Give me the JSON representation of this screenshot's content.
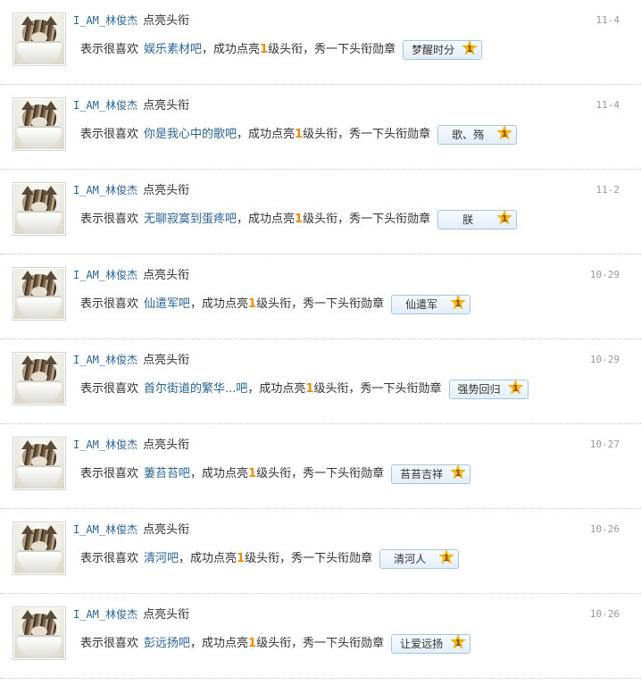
{
  "feed": [
    {
      "user": "I_AM_林俊杰",
      "action": "点亮头衔",
      "date": "11-4",
      "prefix": "表示很喜欢",
      "bar": "娱乐素材吧",
      "mid": "，成功点亮",
      "level": "1",
      "suffix": "级头衔，秀一下头衔勋章",
      "badge": "梦醒时分",
      "badge_level": "1"
    },
    {
      "user": "I_AM_林俊杰",
      "action": "点亮头衔",
      "date": "11-4",
      "prefix": "表示很喜欢",
      "bar": "你是我心中的歌吧",
      "mid": "，成功点亮",
      "level": "1",
      "suffix": "级头衔，秀一下头衔勋章",
      "badge": "歌、殇",
      "badge_level": "1"
    },
    {
      "user": "I_AM_林俊杰",
      "action": "点亮头衔",
      "date": "11-2",
      "prefix": "表示很喜欢",
      "bar": "无聊寂寞到蛋疼吧",
      "mid": "，成功点亮",
      "level": "1",
      "suffix": "级头衔，秀一下头衔勋章",
      "badge": "朕",
      "badge_level": "1"
    },
    {
      "user": "I_AM_林俊杰",
      "action": "点亮头衔",
      "date": "10-29",
      "prefix": "表示很喜欢",
      "bar": "仙遣军吧",
      "mid": "，成功点亮",
      "level": "1",
      "suffix": "级头衔，秀一下头衔勋章",
      "badge": "仙遣军",
      "badge_level": "1"
    },
    {
      "user": "I_AM_林俊杰",
      "action": "点亮头衔",
      "date": "10-29",
      "prefix": "表示很喜欢",
      "bar": "首尔街道的繁华...吧",
      "mid": "，成功点亮",
      "level": "1",
      "suffix": "级头衔，秀一下头衔勋章",
      "badge": "强势回归",
      "badge_level": "1"
    },
    {
      "user": "I_AM_林俊杰",
      "action": "点亮头衔",
      "date": "10-27",
      "prefix": "表示很喜欢",
      "bar": "萋苔苔吧",
      "mid": "，成功点亮",
      "level": "1",
      "suffix": "级头衔，秀一下头衔勋章",
      "badge": "苔苔吉祥",
      "badge_level": "1"
    },
    {
      "user": "I_AM_林俊杰",
      "action": "点亮头衔",
      "date": "10-26",
      "prefix": "表示很喜欢",
      "bar": "清河吧",
      "mid": "，成功点亮",
      "level": "1",
      "suffix": "级头衔，秀一下头衔勋章",
      "badge": "清河人",
      "badge_level": "1"
    },
    {
      "user": "I_AM_林俊杰",
      "action": "点亮头衔",
      "date": "10-26",
      "prefix": "表示很喜欢",
      "bar": "彭远扬吧",
      "mid": "，成功点亮",
      "level": "1",
      "suffix": "级头衔，秀一下头衔勋章",
      "badge": "让爱远扬",
      "badge_level": "1"
    }
  ],
  "icons": {
    "avatar": "cat-in-cup-avatar",
    "badge_star": "star-icon"
  },
  "colors": {
    "link": "#2a6496",
    "level": "#f08a00",
    "star": "#f5b400",
    "date": "#999999",
    "badge_border": "#a9c6e0"
  }
}
